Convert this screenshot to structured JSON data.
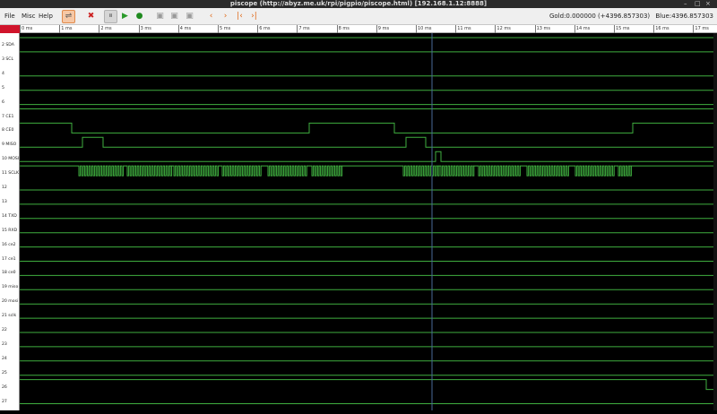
{
  "window": {
    "title": "piscope (http://abyz.me.uk/rpi/pigpio/piscope.html) [192.168.1.12:8888]",
    "controls": {
      "minimize": "–",
      "maximize": "□",
      "close": "×"
    }
  },
  "menu": [
    "File",
    "Misc",
    "Help"
  ],
  "toolbar": {
    "buttons": [
      {
        "id": "capture-mode",
        "icon": "signal-icon",
        "glyph": "⇌",
        "pressed": true,
        "highlight": true
      },
      {
        "id": "tools",
        "icon": "tools-icon",
        "glyph": "✖",
        "pressed": false
      },
      {
        "id": "pause",
        "icon": "pause-icon",
        "glyph": "⏸",
        "pressed": true
      },
      {
        "id": "play",
        "icon": "play-icon",
        "glyph": "▶",
        "pressed": false
      },
      {
        "id": "live",
        "icon": "check-icon",
        "glyph": "●",
        "pressed": false
      },
      {
        "id": "snap1",
        "icon": "snapshot-icon",
        "glyph": "▣",
        "pressed": false
      },
      {
        "id": "snap2",
        "icon": "snapshot-icon",
        "glyph": "▣",
        "pressed": false
      },
      {
        "id": "snap3",
        "icon": "snapshot-icon",
        "glyph": "▣",
        "pressed": false
      },
      {
        "id": "prev",
        "icon": "chevron-left-icon",
        "glyph": "‹",
        "pressed": false
      },
      {
        "id": "next",
        "icon": "chevron-right-icon",
        "glyph": "›",
        "pressed": false
      },
      {
        "id": "first",
        "icon": "skip-back-icon",
        "glyph": "|‹",
        "pressed": false
      },
      {
        "id": "last",
        "icon": "skip-forward-icon",
        "glyph": "›|",
        "pressed": false
      }
    ]
  },
  "status": {
    "gold": "Gold:0.000000 (+4396.857303)",
    "blue": "Blue:4396.857303"
  },
  "ruler": {
    "ticks": [
      "0 ms",
      "1 ms",
      "2 ms",
      "3 ms",
      "4 ms",
      "5 ms",
      "6 ms",
      "7 ms",
      "8 ms",
      "9 ms",
      "10 ms",
      "11 ms",
      "12 ms",
      "13 ms",
      "14 ms",
      "15 ms",
      "16 ms",
      "17 ms"
    ]
  },
  "channels": [
    {
      "label": "2 SDA"
    },
    {
      "label": "3 SCL"
    },
    {
      "label": "4"
    },
    {
      "label": "5"
    },
    {
      "label": "6"
    },
    {
      "label": "7 CE1"
    },
    {
      "label": "8 CE0"
    },
    {
      "label": "9 MISO"
    },
    {
      "label": "10 MOSI"
    },
    {
      "label": "11 SCLK"
    },
    {
      "label": "12"
    },
    {
      "label": "13"
    },
    {
      "label": "14 TXD"
    },
    {
      "label": "15 RXD"
    },
    {
      "label": "16 ce2"
    },
    {
      "label": "17 ce1"
    },
    {
      "label": "18 ce0"
    },
    {
      "label": "19 miso"
    },
    {
      "label": "20 mosi"
    },
    {
      "label": "21 sclk"
    },
    {
      "label": "22"
    },
    {
      "label": "23"
    },
    {
      "label": "24"
    },
    {
      "label": "25"
    },
    {
      "label": "26"
    },
    {
      "label": "27"
    }
  ],
  "colors": {
    "trace": "#3fae3f",
    "cursor_blue": "#4a6a99",
    "background": "#000000",
    "ruler_marker": "#d0142b"
  }
}
